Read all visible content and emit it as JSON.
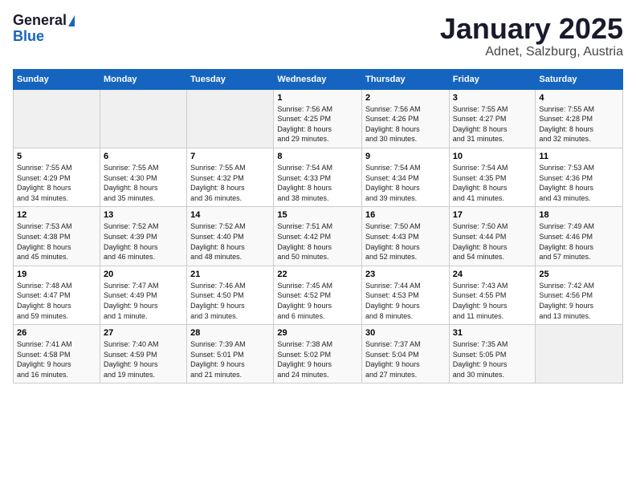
{
  "logo": {
    "line1": "General",
    "line2": "Blue"
  },
  "title": "January 2025",
  "subtitle": "Adnet, Salzburg, Austria",
  "days_header": [
    "Sunday",
    "Monday",
    "Tuesday",
    "Wednesday",
    "Thursday",
    "Friday",
    "Saturday"
  ],
  "weeks": [
    [
      {
        "day": "",
        "info": ""
      },
      {
        "day": "",
        "info": ""
      },
      {
        "day": "",
        "info": ""
      },
      {
        "day": "1",
        "info": "Sunrise: 7:56 AM\nSunset: 4:25 PM\nDaylight: 8 hours\nand 29 minutes."
      },
      {
        "day": "2",
        "info": "Sunrise: 7:56 AM\nSunset: 4:26 PM\nDaylight: 8 hours\nand 30 minutes."
      },
      {
        "day": "3",
        "info": "Sunrise: 7:55 AM\nSunset: 4:27 PM\nDaylight: 8 hours\nand 31 minutes."
      },
      {
        "day": "4",
        "info": "Sunrise: 7:55 AM\nSunset: 4:28 PM\nDaylight: 8 hours\nand 32 minutes."
      }
    ],
    [
      {
        "day": "5",
        "info": "Sunrise: 7:55 AM\nSunset: 4:29 PM\nDaylight: 8 hours\nand 34 minutes."
      },
      {
        "day": "6",
        "info": "Sunrise: 7:55 AM\nSunset: 4:30 PM\nDaylight: 8 hours\nand 35 minutes."
      },
      {
        "day": "7",
        "info": "Sunrise: 7:55 AM\nSunset: 4:32 PM\nDaylight: 8 hours\nand 36 minutes."
      },
      {
        "day": "8",
        "info": "Sunrise: 7:54 AM\nSunset: 4:33 PM\nDaylight: 8 hours\nand 38 minutes."
      },
      {
        "day": "9",
        "info": "Sunrise: 7:54 AM\nSunset: 4:34 PM\nDaylight: 8 hours\nand 39 minutes."
      },
      {
        "day": "10",
        "info": "Sunrise: 7:54 AM\nSunset: 4:35 PM\nDaylight: 8 hours\nand 41 minutes."
      },
      {
        "day": "11",
        "info": "Sunrise: 7:53 AM\nSunset: 4:36 PM\nDaylight: 8 hours\nand 43 minutes."
      }
    ],
    [
      {
        "day": "12",
        "info": "Sunrise: 7:53 AM\nSunset: 4:38 PM\nDaylight: 8 hours\nand 45 minutes."
      },
      {
        "day": "13",
        "info": "Sunrise: 7:52 AM\nSunset: 4:39 PM\nDaylight: 8 hours\nand 46 minutes."
      },
      {
        "day": "14",
        "info": "Sunrise: 7:52 AM\nSunset: 4:40 PM\nDaylight: 8 hours\nand 48 minutes."
      },
      {
        "day": "15",
        "info": "Sunrise: 7:51 AM\nSunset: 4:42 PM\nDaylight: 8 hours\nand 50 minutes."
      },
      {
        "day": "16",
        "info": "Sunrise: 7:50 AM\nSunset: 4:43 PM\nDaylight: 8 hours\nand 52 minutes."
      },
      {
        "day": "17",
        "info": "Sunrise: 7:50 AM\nSunset: 4:44 PM\nDaylight: 8 hours\nand 54 minutes."
      },
      {
        "day": "18",
        "info": "Sunrise: 7:49 AM\nSunset: 4:46 PM\nDaylight: 8 hours\nand 57 minutes."
      }
    ],
    [
      {
        "day": "19",
        "info": "Sunrise: 7:48 AM\nSunset: 4:47 PM\nDaylight: 8 hours\nand 59 minutes."
      },
      {
        "day": "20",
        "info": "Sunrise: 7:47 AM\nSunset: 4:49 PM\nDaylight: 9 hours\nand 1 minute."
      },
      {
        "day": "21",
        "info": "Sunrise: 7:46 AM\nSunset: 4:50 PM\nDaylight: 9 hours\nand 3 minutes."
      },
      {
        "day": "22",
        "info": "Sunrise: 7:45 AM\nSunset: 4:52 PM\nDaylight: 9 hours\nand 6 minutes."
      },
      {
        "day": "23",
        "info": "Sunrise: 7:44 AM\nSunset: 4:53 PM\nDaylight: 9 hours\nand 8 minutes."
      },
      {
        "day": "24",
        "info": "Sunrise: 7:43 AM\nSunset: 4:55 PM\nDaylight: 9 hours\nand 11 minutes."
      },
      {
        "day": "25",
        "info": "Sunrise: 7:42 AM\nSunset: 4:56 PM\nDaylight: 9 hours\nand 13 minutes."
      }
    ],
    [
      {
        "day": "26",
        "info": "Sunrise: 7:41 AM\nSunset: 4:58 PM\nDaylight: 9 hours\nand 16 minutes."
      },
      {
        "day": "27",
        "info": "Sunrise: 7:40 AM\nSunset: 4:59 PM\nDaylight: 9 hours\nand 19 minutes."
      },
      {
        "day": "28",
        "info": "Sunrise: 7:39 AM\nSunset: 5:01 PM\nDaylight: 9 hours\nand 21 minutes."
      },
      {
        "day": "29",
        "info": "Sunrise: 7:38 AM\nSunset: 5:02 PM\nDaylight: 9 hours\nand 24 minutes."
      },
      {
        "day": "30",
        "info": "Sunrise: 7:37 AM\nSunset: 5:04 PM\nDaylight: 9 hours\nand 27 minutes."
      },
      {
        "day": "31",
        "info": "Sunrise: 7:35 AM\nSunset: 5:05 PM\nDaylight: 9 hours\nand 30 minutes."
      },
      {
        "day": "",
        "info": ""
      }
    ]
  ]
}
